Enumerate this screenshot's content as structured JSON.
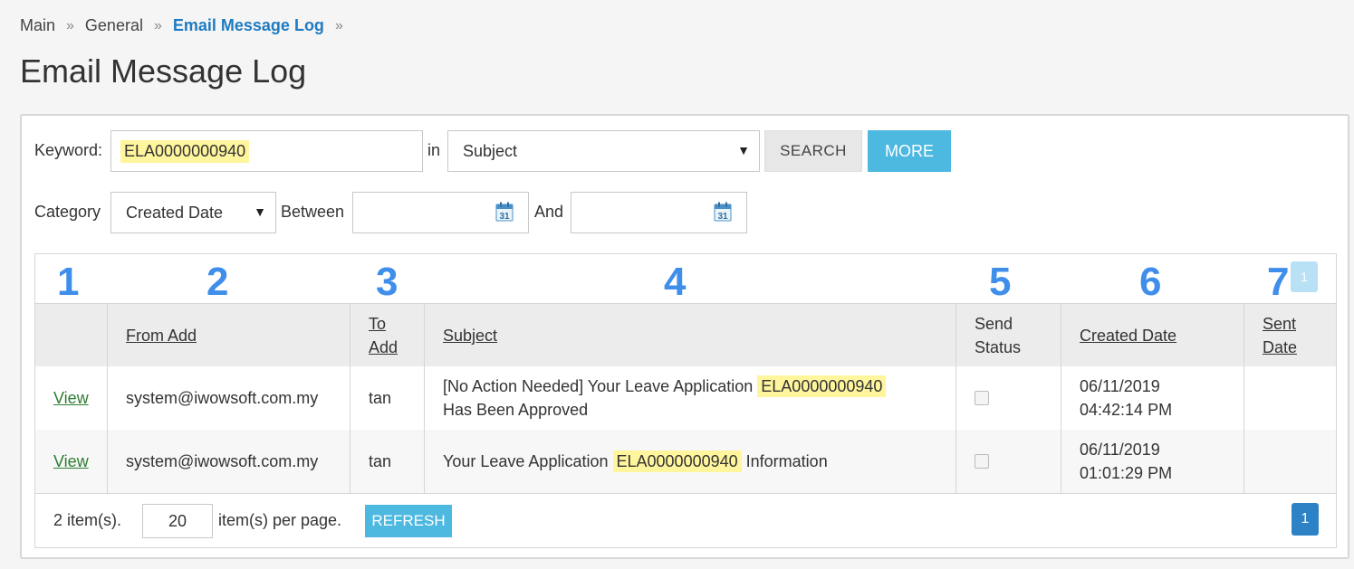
{
  "breadcrumb": {
    "items": [
      "Main",
      "General"
    ],
    "current": "Email Message Log",
    "separator": "»"
  },
  "page_title": "Email Message Log",
  "search": {
    "keyword_label": "Keyword:",
    "keyword_value": "ELA0000000940",
    "in_label": "in",
    "field_selected": "Subject",
    "search_button": "SEARCH",
    "more_button": "MORE",
    "category_label": "Category",
    "category_selected": "Created Date",
    "between_label": "Between",
    "between_value": "",
    "and_label": "And",
    "and_value": "",
    "calendar_day": "31"
  },
  "annotations": [
    "1",
    "2",
    "3",
    "4",
    "5",
    "6",
    "7"
  ],
  "top_page_badge": "1",
  "table": {
    "columns": {
      "from": "From Add",
      "to_1": "To",
      "to_2": "Add",
      "subject": "Subject",
      "status_1": "Send",
      "status_2": "Status",
      "created": "Created Date",
      "sent_1": "Sent",
      "sent_2": "Date"
    },
    "rows": [
      {
        "view": "View",
        "from": "system@iwowsoft.com.my",
        "to": "tan",
        "subject_pre": "[No Action Needed] Your Leave Application",
        "subject_hl": "ELA0000000940",
        "subject_post": "Has Been Approved",
        "created_date": "06/11/2019",
        "created_time": "04:42:14 PM",
        "sent": ""
      },
      {
        "view": "View",
        "from": "system@iwowsoft.com.my",
        "to": "tan",
        "subject_pre": "Your Leave Application",
        "subject_hl": "ELA0000000940",
        "subject_post": "Information",
        "created_date": "06/11/2019",
        "created_time": "01:01:29 PM",
        "sent": ""
      }
    ]
  },
  "footer": {
    "item_count": "2 item(s).",
    "per_page_value": "20",
    "per_page_label": "item(s) per page.",
    "refresh_button": "REFRESH",
    "current_page": "1"
  },
  "colors": {
    "accent": "#4db8e0",
    "highlight": "#fff59d",
    "link": "#1f7bc2",
    "annotation": "#3f8eea",
    "page": "#2d82c6"
  }
}
